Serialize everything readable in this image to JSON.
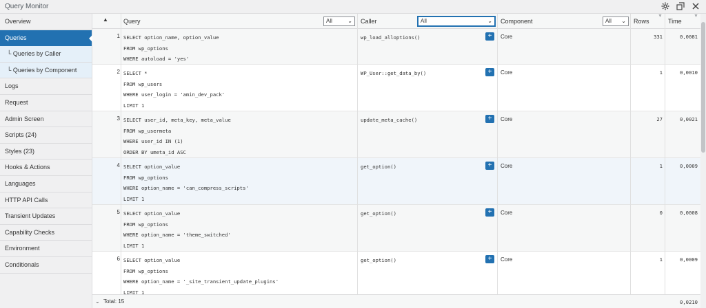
{
  "window": {
    "title": "Query Monitor",
    "icons": [
      "gear-icon",
      "popout-icon",
      "close-icon"
    ]
  },
  "sidebar": {
    "items": [
      {
        "label": "Overview",
        "state": "normal"
      },
      {
        "label": "Queries",
        "state": "active"
      },
      {
        "label": "└ Queries by Caller",
        "state": "sub"
      },
      {
        "label": "└ Queries by Component",
        "state": "sub"
      },
      {
        "label": "Logs",
        "state": "normal"
      },
      {
        "label": "Request",
        "state": "normal"
      },
      {
        "label": "Admin Screen",
        "state": "normal"
      },
      {
        "label": "Scripts (24)",
        "state": "normal"
      },
      {
        "label": "Styles (23)",
        "state": "normal"
      },
      {
        "label": "Hooks & Actions",
        "state": "normal"
      },
      {
        "label": "Languages",
        "state": "normal"
      },
      {
        "label": "HTTP API Calls",
        "state": "normal"
      },
      {
        "label": "Transient Updates",
        "state": "normal"
      },
      {
        "label": "Capability Checks",
        "state": "normal"
      },
      {
        "label": "Environment",
        "state": "normal"
      },
      {
        "label": "Conditionals",
        "state": "normal"
      }
    ]
  },
  "table": {
    "headers": {
      "sort": "▲",
      "query": "Query",
      "query_filter": "All",
      "caller": "Caller",
      "caller_filter": "All",
      "component": "Component",
      "component_filter": "All",
      "rows": "Rows",
      "time": "Time"
    },
    "rows": [
      {
        "num": "1",
        "sql": "SELECT option_name, option_value\nFROM wp_options\nWHERE autoload = 'yes'",
        "caller": "wp_load_alloptions()",
        "component": "Core",
        "rows": "331",
        "time": "0,0081"
      },
      {
        "num": "2",
        "sql": "SELECT *\nFROM wp_users\nWHERE user_login = 'amin_dev_pack'\nLIMIT 1",
        "caller": "WP_User::get_data_by()",
        "component": "Core",
        "rows": "1",
        "time": "0,0010"
      },
      {
        "num": "3",
        "sql": "SELECT user_id, meta_key, meta_value\nFROM wp_usermeta\nWHERE user_id IN (1)\nORDER BY umeta_id ASC",
        "caller": "update_meta_cache()",
        "component": "Core",
        "rows": "27",
        "time": "0,0021"
      },
      {
        "num": "4",
        "sql": "SELECT option_value\nFROM wp_options\nWHERE option_name = 'can_compress_scripts'\nLIMIT 1",
        "caller": "get_option()",
        "component": "Core",
        "rows": "1",
        "time": "0,0009"
      },
      {
        "num": "5",
        "sql": "SELECT option_value\nFROM wp_options\nWHERE option_name = 'theme_switched'\nLIMIT 1",
        "caller": "get_option()",
        "component": "Core",
        "rows": "0",
        "time": "0,0008"
      },
      {
        "num": "6",
        "sql": "SELECT option_value\nFROM wp_options\nWHERE option_name = '_site_transient_update_plugins'\nLIMIT 1",
        "caller": "get_option()",
        "component": "Core",
        "rows": "1",
        "time": "0,0009"
      }
    ],
    "footer": {
      "total": "Total: 15",
      "time": "0,0210"
    }
  },
  "colors": {
    "accent": "#2271b1",
    "sub_nav_bg": "#e5f0f9",
    "highlight_row": "#f0f5fa"
  }
}
